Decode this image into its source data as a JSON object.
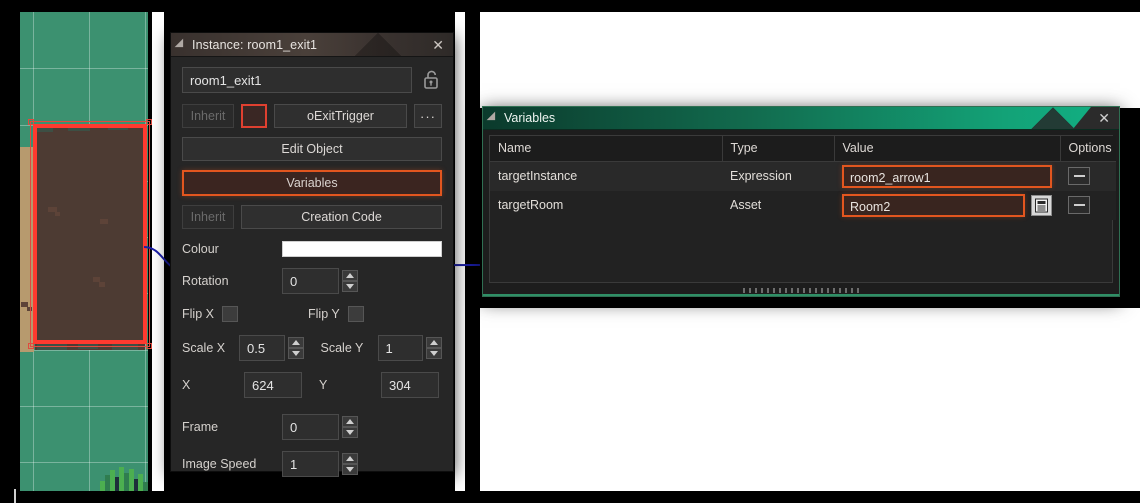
{
  "instance_panel": {
    "title": "Instance: room1_exit1",
    "close_label": "✕",
    "name_value": "room1_exit1",
    "lock_icon": "unlocked-padlock-icon",
    "inherit_label": "Inherit",
    "object_name": "oExitTrigger",
    "object_colour_hex": "#3a2724",
    "ellipsis_label": "···",
    "edit_object_label": "Edit Object",
    "variables_label": "Variables",
    "creation_code_label": "Creation Code",
    "colour_label": "Colour",
    "colour_value_hex": "#ffffff",
    "rotation_label": "Rotation",
    "rotation_value": "0",
    "flip_x_label": "Flip X",
    "flip_y_label": "Flip Y",
    "scale_x_label": "Scale X",
    "scale_x_value": "0.5",
    "scale_y_label": "Scale Y",
    "scale_y_value": "1",
    "x_label": "X",
    "x_value": "624",
    "y_label": "Y",
    "y_value": "304",
    "frame_label": "Frame",
    "frame_value": "0",
    "image_speed_label": "Image Speed",
    "image_speed_value": "1",
    "accent_hex": "#e2561f"
  },
  "variables_panel": {
    "title": "Variables",
    "close_label": "✕",
    "accent_hex": "#11b184",
    "headers": [
      "Name",
      "Type",
      "Value",
      "Options"
    ],
    "rows": [
      {
        "name": "targetInstance",
        "type": "Expression",
        "value": "room2_arrow1",
        "has_asset_picker": false,
        "remove_label": "−"
      },
      {
        "name": "targetRoom",
        "type": "Asset",
        "value": "Room2",
        "has_asset_picker": true,
        "asset_picker_icon": "asset-list-icon",
        "remove_label": "−"
      }
    ]
  },
  "room_view": {
    "grass_hex": "#3c9170",
    "dirt_hex": "#4d3b33",
    "path_hex": "#b79a6e",
    "selection_hex": "#ff3a2f",
    "connector_hex": "#1b1fa8"
  }
}
